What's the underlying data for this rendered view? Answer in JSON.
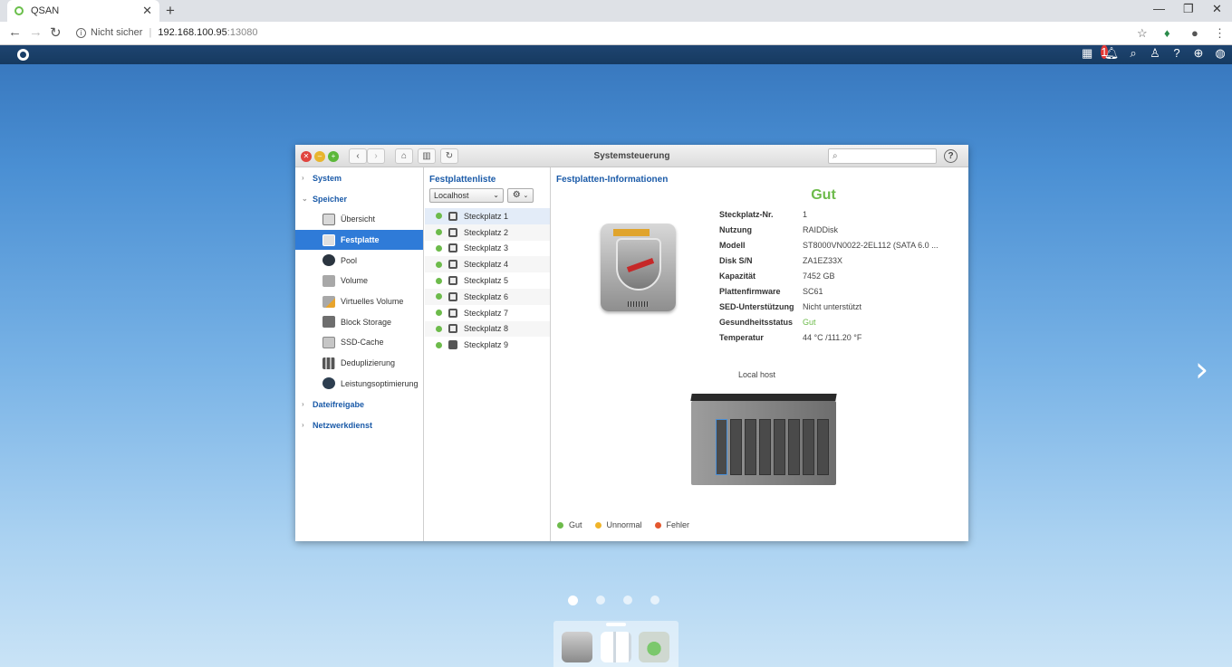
{
  "browser": {
    "tab_title": "QSAN",
    "tab_close": "✕",
    "new_tab": "+",
    "security": "Nicht sicher",
    "url_host": "192.168.100.95",
    "url_port": ":13080"
  },
  "appbar": {
    "notification_count": "1"
  },
  "window": {
    "title": "Systemsteuerung",
    "search_placeholder": ""
  },
  "sidebar": {
    "groups": {
      "system": "System",
      "speicher": "Speicher",
      "dateifreigabe": "Dateifreigabe",
      "netzwerkdienst": "Netzwerkdienst"
    },
    "items": [
      {
        "label": "Übersicht"
      },
      {
        "label": "Festplatte"
      },
      {
        "label": "Pool"
      },
      {
        "label": "Volume"
      },
      {
        "label": "Virtuelles Volume"
      },
      {
        "label": "Block Storage"
      },
      {
        "label": "SSD-Cache"
      },
      {
        "label": "Deduplizierung"
      },
      {
        "label": "Leistungsoptimierung"
      }
    ]
  },
  "disklist": {
    "heading": "Festplattenliste",
    "selector": "Localhost",
    "slots": [
      {
        "label": "Steckplatz 1"
      },
      {
        "label": "Steckplatz 2"
      },
      {
        "label": "Steckplatz 3"
      },
      {
        "label": "Steckplatz 4"
      },
      {
        "label": "Steckplatz 5"
      },
      {
        "label": "Steckplatz 6"
      },
      {
        "label": "Steckplatz 7"
      },
      {
        "label": "Steckplatz 8"
      },
      {
        "label": "Steckplatz 9"
      }
    ]
  },
  "details": {
    "heading": "Festplatten-Informationen",
    "status": "Gut",
    "fields": [
      {
        "key": "Steckplatz-Nr.",
        "value": "1"
      },
      {
        "key": "Nutzung",
        "value": "RAIDDisk"
      },
      {
        "key": "Modell",
        "value": "ST8000VN0022-2EL112 (SATA 6.0 ..."
      },
      {
        "key": "Disk S/N",
        "value": "ZA1EZ33X"
      },
      {
        "key": "Kapazität",
        "value": "7452 GB"
      },
      {
        "key": "Plattenfirmware",
        "value": "SC61"
      },
      {
        "key": "SED-Unterstützung",
        "value": "Nicht unterstützt"
      },
      {
        "key": "Gesundheitsstatus",
        "value": "Gut"
      },
      {
        "key": "Temperatur",
        "value": "44 °C /111.20 °F"
      }
    ],
    "host_label": "Local host",
    "legend": [
      {
        "label": "Gut",
        "color": "#6dbb4b"
      },
      {
        "label": "Unnormal",
        "color": "#f0b429"
      },
      {
        "label": "Fehler",
        "color": "#e4572e"
      }
    ]
  }
}
